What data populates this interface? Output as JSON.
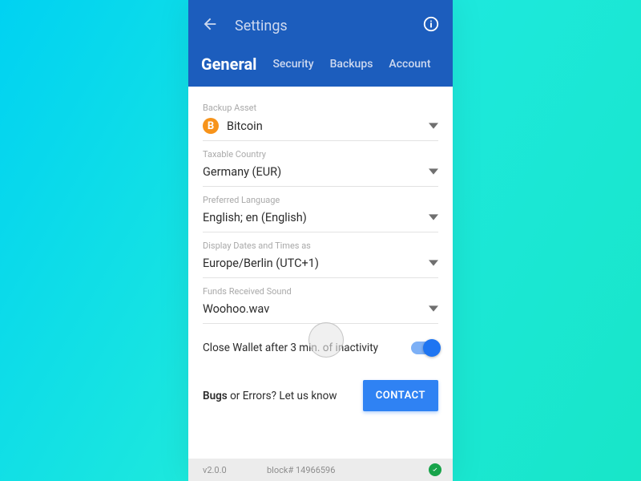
{
  "header": {
    "title": "Settings",
    "tabs": [
      "General",
      "Security",
      "Backups",
      "Account"
    ]
  },
  "fields": {
    "backup_asset": {
      "label": "Backup Asset",
      "value": "Bitcoin",
      "symbol": "B"
    },
    "taxable_country": {
      "label": "Taxable Country",
      "value": "Germany (EUR)"
    },
    "preferred_language": {
      "label": "Preferred Language",
      "value": "English; en (English)"
    },
    "datetime": {
      "label": "Display Dates and Times as",
      "value": "Europe/Berlin (UTC+1)"
    },
    "sound": {
      "label": "Funds Received Sound",
      "value": "Woohoo.wav"
    }
  },
  "toggle": {
    "label": "Close Wallet after 3 min. of inactivity",
    "on": true
  },
  "bugs": {
    "text_bold": "Bugs",
    "text_rest": " or Errors? Let us know",
    "button": "CONTACT"
  },
  "footer": {
    "version": "v2.0.0",
    "block": "block# 14966596"
  }
}
